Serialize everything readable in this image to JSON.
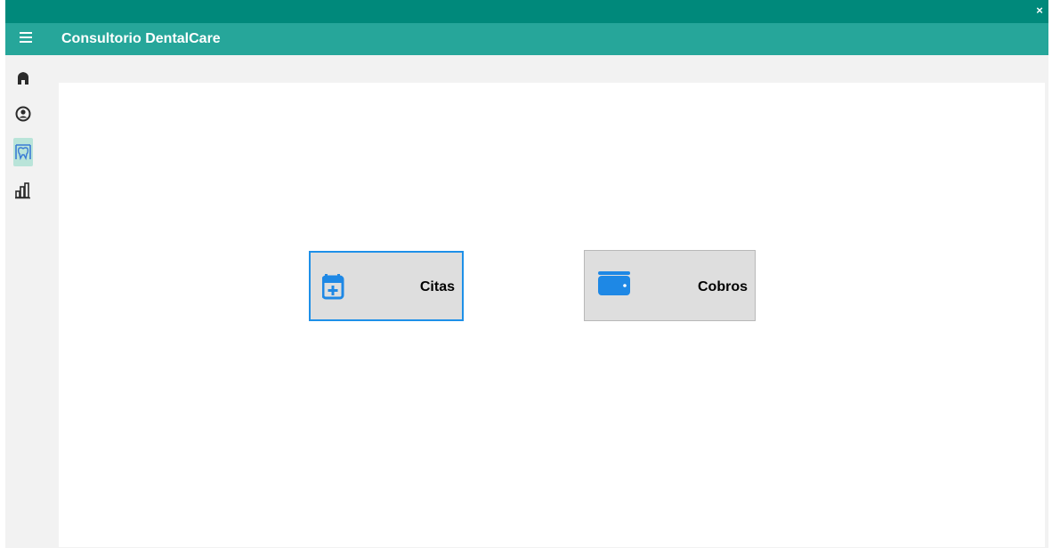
{
  "window": {
    "close_label": "×"
  },
  "appbar": {
    "title": "Consultorio DentalCare",
    "menu_icon": "hamburger-menu-icon"
  },
  "sidebar": {
    "items": [
      {
        "icon": "home-icon",
        "active": false
      },
      {
        "icon": "user-circle-icon",
        "active": false
      },
      {
        "icon": "tooth-icon",
        "active": true
      },
      {
        "icon": "bar-chart-icon",
        "active": false
      }
    ]
  },
  "main": {
    "tiles": [
      {
        "label": "Citas",
        "icon": "calendar-plus-icon",
        "selected": true
      },
      {
        "label": "Cobros",
        "icon": "wallet-icon",
        "selected": false
      }
    ]
  },
  "colors": {
    "titlebar": "#00897b",
    "appbar": "#26a69a",
    "accent": "#1e90e8",
    "active_nav": "#b9e4d9"
  }
}
